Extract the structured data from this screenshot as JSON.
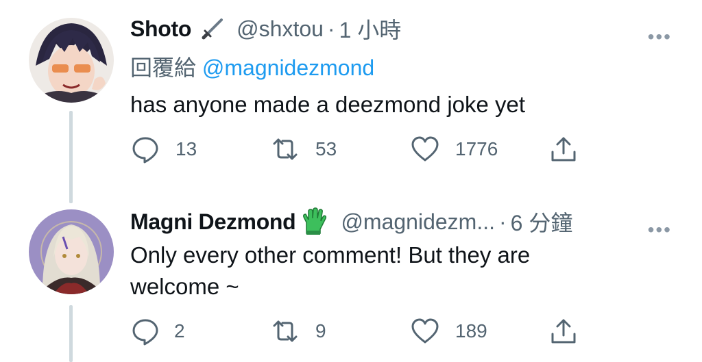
{
  "tweets": [
    {
      "display_name": "Shoto",
      "name_emoji": "dagger-icon",
      "handle": "@shxtou",
      "separator": "·",
      "time": "1 小時",
      "more": "•••",
      "reply_prefix": "回覆給",
      "reply_mention": "@magnidezmond",
      "text": "has anyone made a deezmond joke yet",
      "replies": "13",
      "retweets": "53",
      "likes": "1776"
    },
    {
      "display_name": "Magni Dezmond",
      "name_emoji": "green-glove-icon",
      "handle": "@magnidezm...",
      "separator": "·",
      "time": "6 分鐘",
      "more": "•••",
      "text_line1": "Only every other comment! But they are",
      "text_line2": "welcome ~",
      "replies": "2",
      "retweets": "9",
      "likes": "189"
    }
  ],
  "colors": {
    "text": "#0f1419",
    "secondary": "#536471",
    "link": "#1d9bf0",
    "thread_line": "#cfd9de"
  }
}
